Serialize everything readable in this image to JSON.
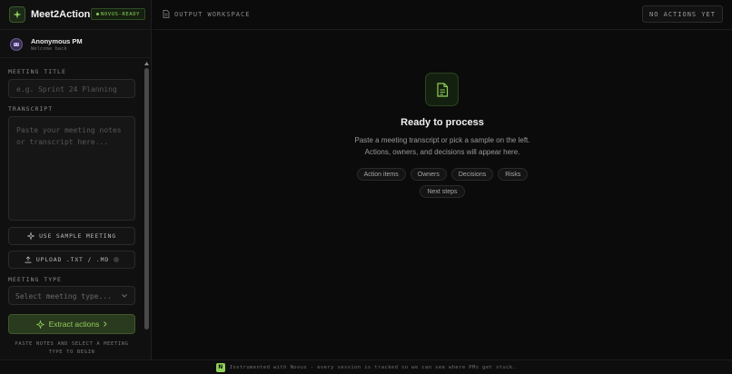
{
  "brand": {
    "name": "Meet2Action",
    "badge": "NOVUS-READY",
    "icon": "sparkle-icon"
  },
  "user": {
    "name": "Anonymous PM",
    "subtitle": "Welcome back"
  },
  "form": {
    "meeting_title_label": "MEETING TITLE",
    "meeting_title_placeholder": "e.g. Sprint 24 Planning",
    "transcript_label": "TRANSCRIPT",
    "transcript_placeholder": "Paste your meeting notes or transcript here...",
    "sample_button": "USE SAMPLE MEETING",
    "upload_button": "UPLOAD .TXT / .MD",
    "meeting_type_label": "MEETING TYPE",
    "meeting_type_placeholder": "Select meeting type...",
    "extract_button": "Extract actions",
    "hint": "PASTE NOTES AND SELECT A MEETING TYPE TO BEGIN"
  },
  "topbar": {
    "workspace_label": "OUTPUT WORKSPACE",
    "actions_status": "NO ACTIONS YET"
  },
  "empty_state": {
    "title": "Ready to process",
    "line1": "Paste a meeting transcript or pick a sample on the left.",
    "line2": "Actions, owners, and decisions will appear here.",
    "chips": [
      "Action items",
      "Owners",
      "Decisions",
      "Risks",
      "Next steps"
    ]
  },
  "footer": {
    "badge": "N",
    "text": "Instrumented with Novus - every session is tracked so we can see where PMs get stuck."
  },
  "colors": {
    "accent": "#8fcf5a",
    "background": "#0b0b0b",
    "panel": "#101010"
  }
}
